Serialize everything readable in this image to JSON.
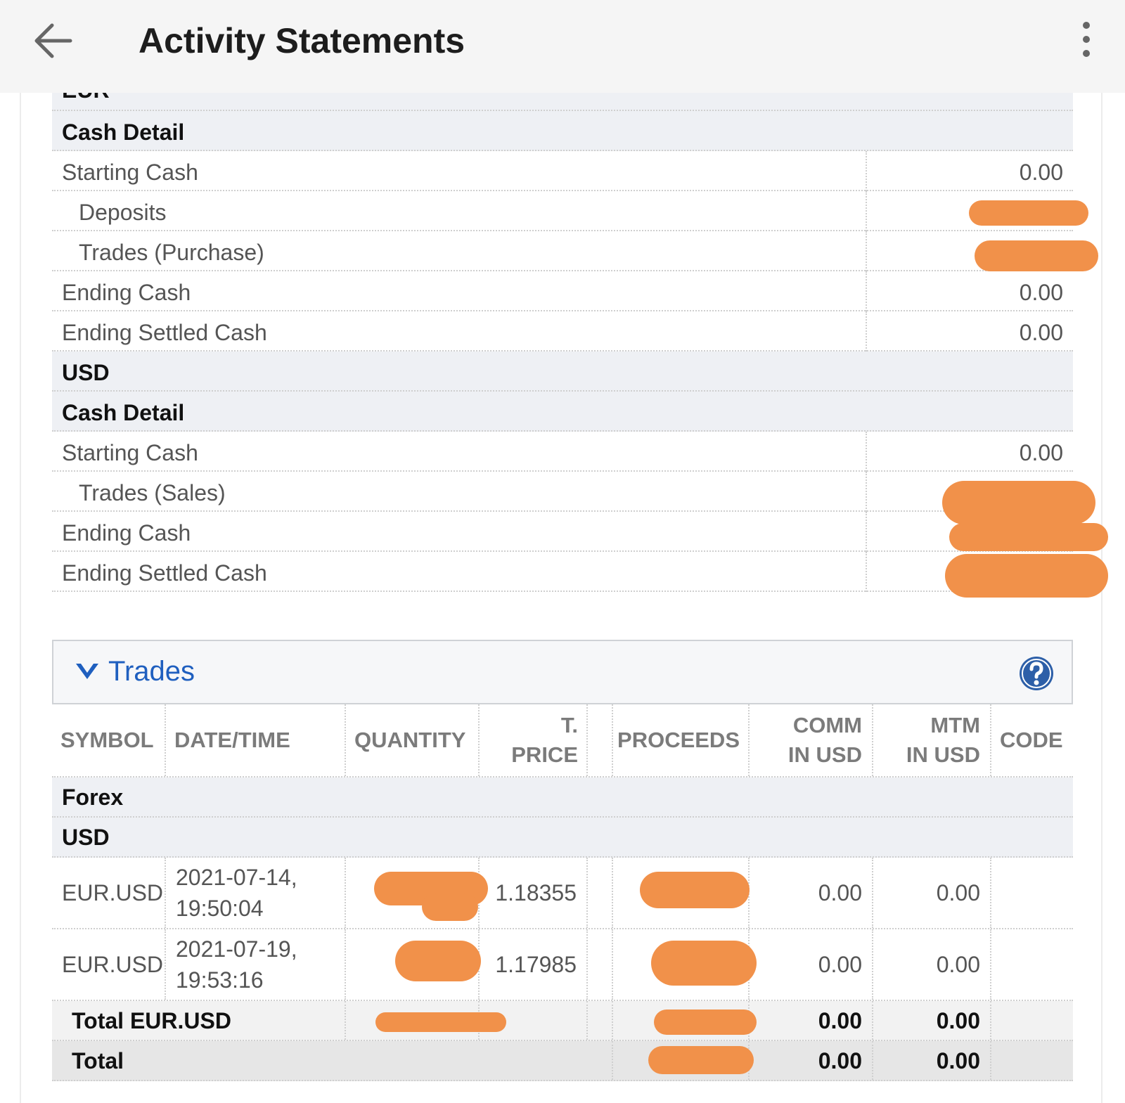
{
  "header": {
    "title": "Activity Statements"
  },
  "cash_report": {
    "eur_section": {
      "clipped_currency": "EUR",
      "group_label": "Cash Detail",
      "rows": [
        {
          "label": "Starting Cash",
          "value": "0.00"
        },
        {
          "label": "Deposits",
          "value": ""
        },
        {
          "label": "Trades (Purchase)",
          "value": ""
        },
        {
          "label": "Ending Cash",
          "value": "0.00"
        },
        {
          "label": "Ending Settled Cash",
          "value": "0.00"
        }
      ]
    },
    "usd_section": {
      "currency": "USD",
      "group_label": "Cash Detail",
      "rows": [
        {
          "label": "Starting Cash",
          "value": "0.00"
        },
        {
          "label": "Trades (Sales)",
          "value": ""
        },
        {
          "label": "Ending Cash",
          "value": ""
        },
        {
          "label": "Ending Settled Cash",
          "value": ""
        }
      ]
    }
  },
  "trades": {
    "title": "Trades",
    "columns": {
      "symbol": "SYMBOL",
      "datetime": "DATE/TIME",
      "quantity": "QUANTITY",
      "tprice_1": "T.",
      "tprice_2": "PRICE",
      "proceeds": "PROCEEDS",
      "comm_1": "COMM",
      "comm_2": "IN USD",
      "mtm_1": "MTM",
      "mtm_2": "IN USD",
      "code": "CODE"
    },
    "asset_class": "Forex",
    "currency": "USD",
    "rows": [
      {
        "symbol": "EUR.USD",
        "date": "2021-07-14,",
        "time": "19:50:04",
        "t_price": "1.18355",
        "comm": "0.00",
        "mtm": "0.00"
      },
      {
        "symbol": "EUR.USD",
        "date": "2021-07-19,",
        "time": "19:53:16",
        "t_price": "1.17985",
        "comm": "0.00",
        "mtm": "0.00"
      }
    ],
    "subtotal": {
      "label": "Total EUR.USD",
      "comm": "0.00",
      "mtm": "0.00"
    },
    "total": {
      "label": "Total",
      "comm": "0.00",
      "mtm": "0.00"
    }
  },
  "colors": {
    "accent": "#1f5fbf",
    "redaction": "#f1914a"
  }
}
